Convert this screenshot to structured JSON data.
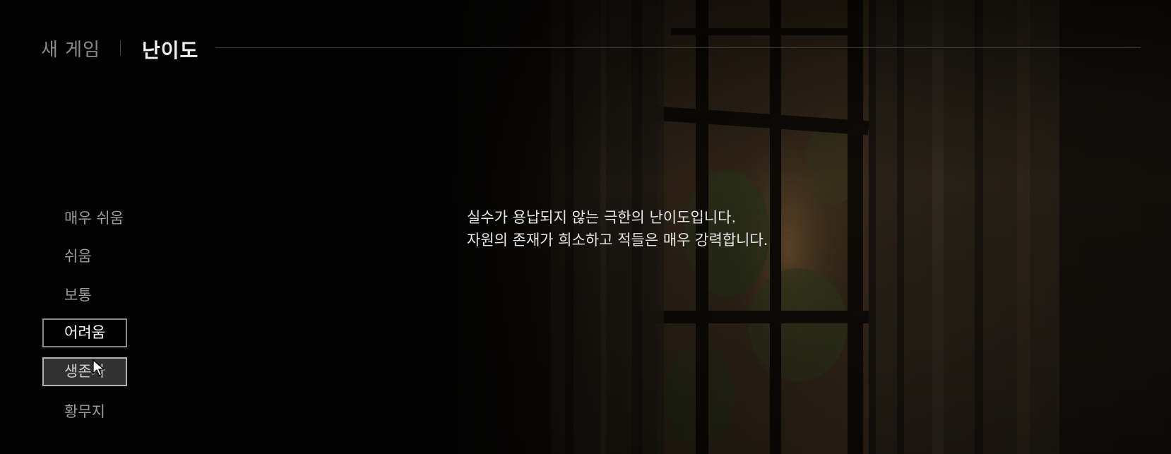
{
  "header": {
    "breadcrumb_parent": "새 게임",
    "title": "난이도"
  },
  "difficulty_list": {
    "items": [
      {
        "label": "매우 쉬움",
        "state": "normal"
      },
      {
        "label": "쉬움",
        "state": "normal"
      },
      {
        "label": "보통",
        "state": "normal"
      },
      {
        "label": "어려움",
        "state": "selected"
      },
      {
        "label": "생존자",
        "state": "hovered"
      },
      {
        "label": "황무지",
        "state": "normal"
      }
    ]
  },
  "description": {
    "line1": "실수가 용납되지 않는 극한의 난이도입니다.",
    "line2": "자원의 존재가 희소하고 적들은 매우 강력합니다."
  },
  "colors": {
    "background": "#020202",
    "selected_text": "#ffffff",
    "normal_text": "#9c9c9c",
    "title_text": "#f0f0f0"
  },
  "icons": {
    "cursor": "mouse-pointer-icon"
  }
}
